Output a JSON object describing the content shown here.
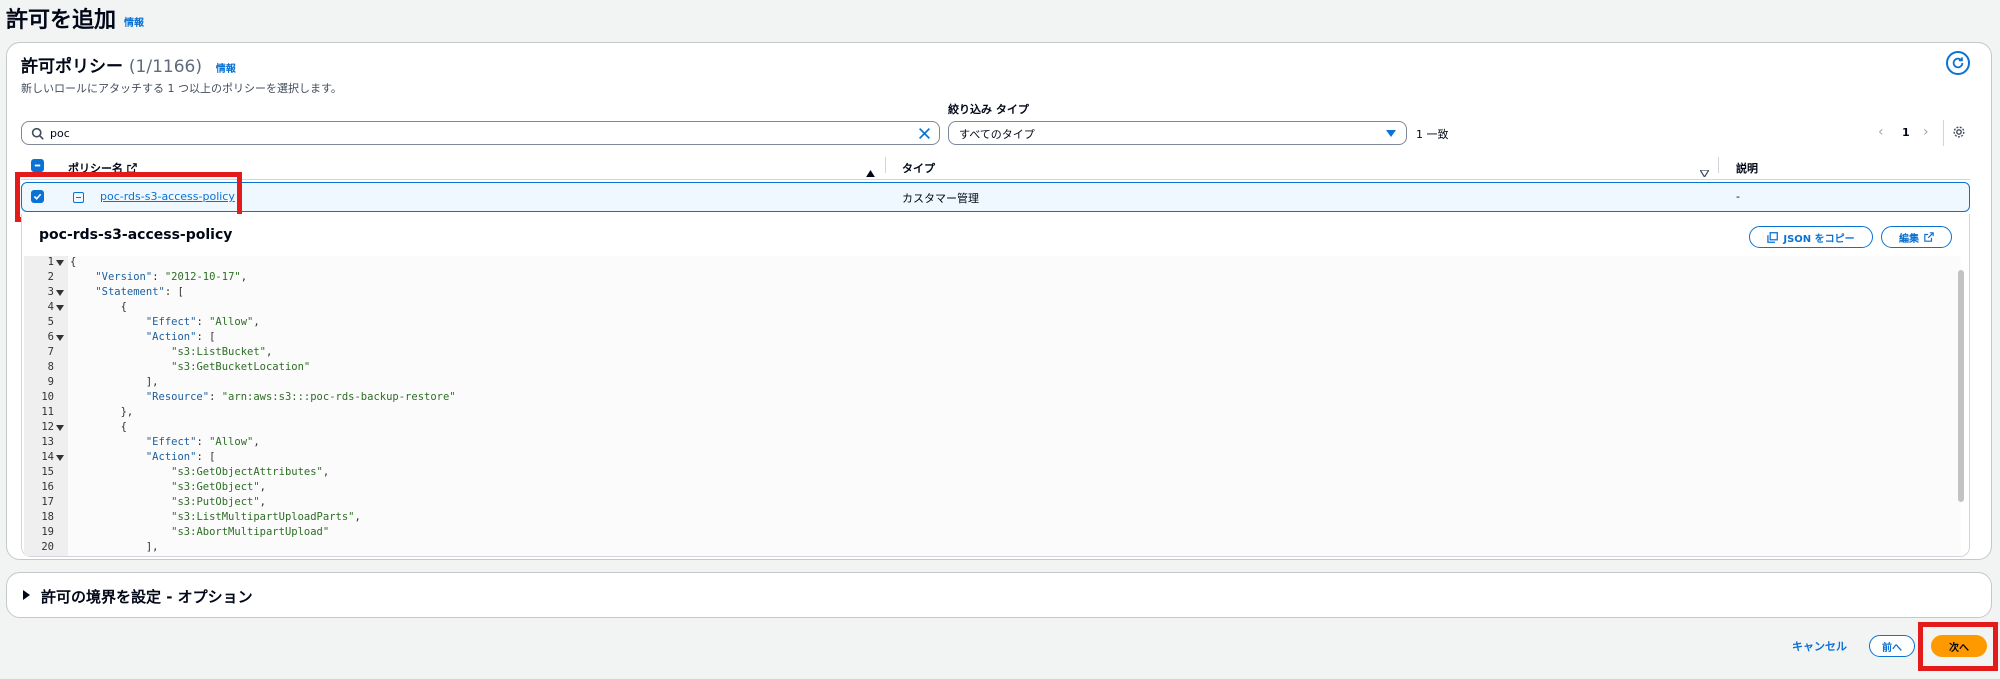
{
  "page": {
    "title": "許可を追加",
    "info": "情報"
  },
  "policies": {
    "title": "許可ポリシー",
    "count": "(1/1166)",
    "info": "情報",
    "description": "新しいロールにアタッチする 1 つ以上のポリシーを選択します。",
    "filter_label": "絞り込み タイプ",
    "search_value": "poc",
    "type_select": "すべてのタイプ",
    "match_count": "1 一致",
    "page_number": "1",
    "columns": {
      "name": "ポリシー名",
      "type": "タイプ",
      "description": "説明"
    },
    "rows": [
      {
        "name": "poc-rds-s3-access-policy",
        "type": "カスタマー管理",
        "description": "-",
        "selected": true
      }
    ]
  },
  "detail": {
    "title": "poc-rds-s3-access-policy",
    "copy_json": "JSON をコピー",
    "edit": "編集",
    "code_lines": [
      {
        "n": "1",
        "fold": true,
        "indent": "",
        "parts": [
          [
            "p",
            "{"
          ]
        ]
      },
      {
        "n": "2",
        "fold": false,
        "indent": "    ",
        "parts": [
          [
            "k",
            "\"Version\""
          ],
          [
            "p",
            ": "
          ],
          [
            "s",
            "\"2012-10-17\""
          ],
          [
            "p",
            ","
          ]
        ]
      },
      {
        "n": "3",
        "fold": true,
        "indent": "    ",
        "parts": [
          [
            "k",
            "\"Statement\""
          ],
          [
            "p",
            ": ["
          ]
        ]
      },
      {
        "n": "4",
        "fold": true,
        "indent": "        ",
        "parts": [
          [
            "p",
            "{"
          ]
        ]
      },
      {
        "n": "5",
        "fold": false,
        "indent": "            ",
        "parts": [
          [
            "k",
            "\"Effect\""
          ],
          [
            "p",
            ": "
          ],
          [
            "s",
            "\"Allow\""
          ],
          [
            "p",
            ","
          ]
        ]
      },
      {
        "n": "6",
        "fold": true,
        "indent": "            ",
        "parts": [
          [
            "k",
            "\"Action\""
          ],
          [
            "p",
            ": ["
          ]
        ]
      },
      {
        "n": "7",
        "fold": false,
        "indent": "                ",
        "parts": [
          [
            "s",
            "\"s3:ListBucket\""
          ],
          [
            "p",
            ","
          ]
        ]
      },
      {
        "n": "8",
        "fold": false,
        "indent": "                ",
        "parts": [
          [
            "s",
            "\"s3:GetBucketLocation\""
          ]
        ]
      },
      {
        "n": "9",
        "fold": false,
        "indent": "            ",
        "parts": [
          [
            "p",
            "],"
          ]
        ]
      },
      {
        "n": "10",
        "fold": false,
        "indent": "            ",
        "parts": [
          [
            "k",
            "\"Resource\""
          ],
          [
            "p",
            ": "
          ],
          [
            "s",
            "\"arn:aws:s3:::poc-rds-backup-restore\""
          ]
        ]
      },
      {
        "n": "11",
        "fold": false,
        "indent": "        ",
        "parts": [
          [
            "p",
            "},"
          ]
        ]
      },
      {
        "n": "12",
        "fold": true,
        "indent": "        ",
        "parts": [
          [
            "p",
            "{"
          ]
        ]
      },
      {
        "n": "13",
        "fold": false,
        "indent": "            ",
        "parts": [
          [
            "k",
            "\"Effect\""
          ],
          [
            "p",
            ": "
          ],
          [
            "s",
            "\"Allow\""
          ],
          [
            "p",
            ","
          ]
        ]
      },
      {
        "n": "14",
        "fold": true,
        "indent": "            ",
        "parts": [
          [
            "k",
            "\"Action\""
          ],
          [
            "p",
            ": ["
          ]
        ]
      },
      {
        "n": "15",
        "fold": false,
        "indent": "                ",
        "parts": [
          [
            "s",
            "\"s3:GetObjectAttributes\""
          ],
          [
            "p",
            ","
          ]
        ]
      },
      {
        "n": "16",
        "fold": false,
        "indent": "                ",
        "parts": [
          [
            "s",
            "\"s3:GetObject\""
          ],
          [
            "p",
            ","
          ]
        ]
      },
      {
        "n": "17",
        "fold": false,
        "indent": "                ",
        "parts": [
          [
            "s",
            "\"s3:PutObject\""
          ],
          [
            "p",
            ","
          ]
        ]
      },
      {
        "n": "18",
        "fold": false,
        "indent": "                ",
        "parts": [
          [
            "s",
            "\"s3:ListMultipartUploadParts\""
          ],
          [
            "p",
            ","
          ]
        ]
      },
      {
        "n": "19",
        "fold": false,
        "indent": "                ",
        "parts": [
          [
            "s",
            "\"s3:AbortMultipartUpload\""
          ]
        ]
      },
      {
        "n": "20",
        "fold": false,
        "indent": "            ",
        "parts": [
          [
            "p",
            "],"
          ]
        ]
      }
    ]
  },
  "boundary": {
    "title": "許可の境界を設定 - オプション"
  },
  "footer": {
    "cancel": "キャンセル",
    "prev": "前へ",
    "next": "次へ"
  },
  "colors": {
    "accent": "#0972d3",
    "primary_button": "#ff9900",
    "highlight_box": "#e31b1b"
  },
  "icons": [
    "search-icon",
    "close-icon",
    "refresh-icon",
    "chevron-left-icon",
    "chevron-right-icon",
    "gear-icon",
    "external-link-icon",
    "copy-icon",
    "caret-right-icon",
    "sort-ascending-icon",
    "sort-descending-icon"
  ]
}
